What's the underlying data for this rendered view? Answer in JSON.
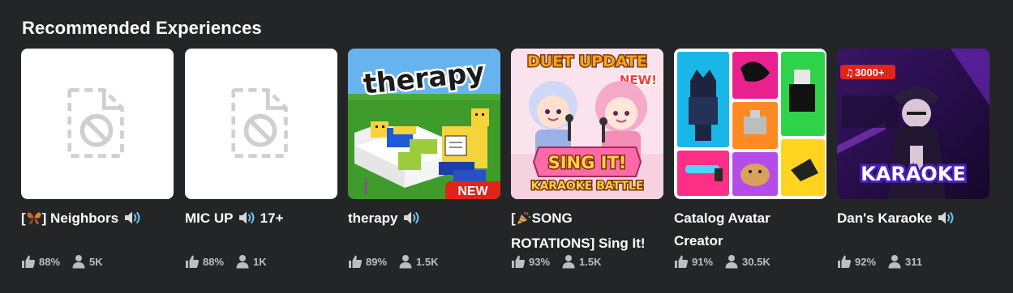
{
  "section": {
    "title": "Recommended Experiences"
  },
  "colors": {
    "background": "#232527",
    "text": "#ffffff",
    "stat_text": "#bdbebe",
    "placeholder_bg": "#ffffff",
    "placeholder_icon": "#cfcfcf",
    "new_badge": "#e2231a",
    "speaker_accent": "#6ec6ff"
  },
  "games": [
    {
      "name_bracket_open": "[",
      "name_emoji": "butterfly-emoji",
      "name_rest": "] Neighbors",
      "voice_icon": "speaker-icon",
      "thumbnail": "placeholder-broken-image-icon",
      "rating": "88%",
      "players": "5K"
    },
    {
      "name": "MIC UP",
      "voice_icon": "speaker-icon",
      "name_suffix": "17+",
      "thumbnail": "placeholder-broken-image-icon",
      "rating": "88%",
      "players": "1K"
    },
    {
      "name": "therapy",
      "voice_icon": "speaker-icon",
      "thumbnail_text": "therapy",
      "badge": "NEW",
      "rating": "89%",
      "players": "1.5K"
    },
    {
      "name_line1_open": "[",
      "name_emoji": "party-popper-emoji",
      "name_line1_rest": "SONG",
      "name_line2": "ROTATIONS] Sing It!",
      "thumbnail_top": "DUET UPDATE",
      "thumbnail_new": "NEW!",
      "thumbnail_sign": "SING IT!",
      "thumbnail_sub": "KARAOKE BATTLE",
      "rating": "93%",
      "players": "1.5K"
    },
    {
      "name_line1": "Catalog Avatar",
      "name_line2": "Creator",
      "thumbnail": "avatar-items-grid",
      "rating": "91%",
      "players": "30.5K"
    },
    {
      "name": "Dan's Karaoke",
      "voice_icon": "speaker-icon",
      "thumbnail_badge": "3000+",
      "thumbnail_text": "KARAOKE",
      "rating": "92%",
      "players": "311"
    }
  ]
}
